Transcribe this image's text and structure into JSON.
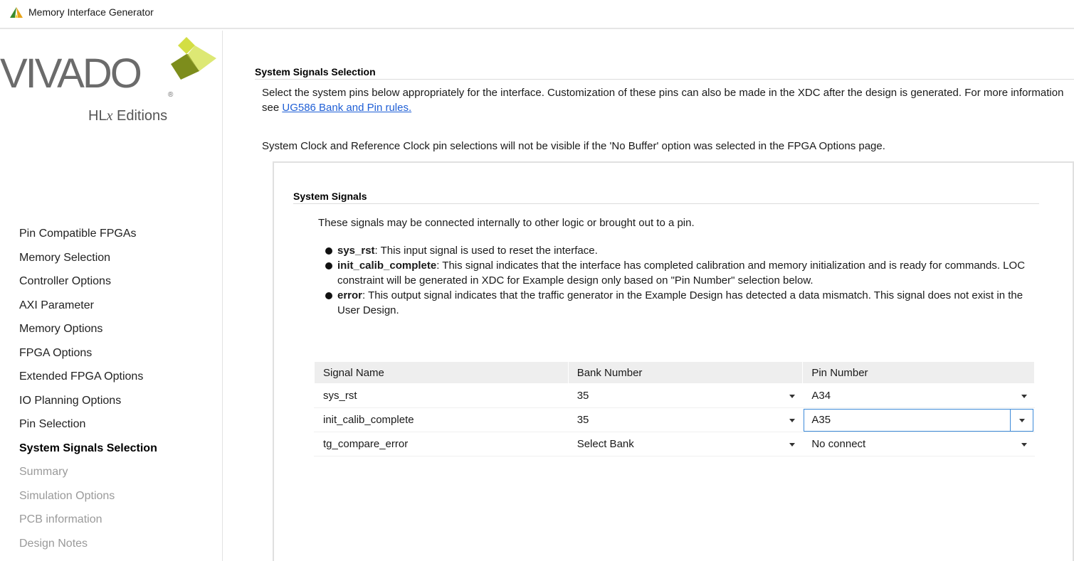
{
  "window": {
    "title": "Memory Interface Generator",
    "icon": "vivado-app-icon"
  },
  "logo": {
    "word": "VIVADO",
    "reg": "®",
    "sub_prefix": "HL",
    "sub_italic": "x",
    "sub_suffix": " Editions"
  },
  "sidebar": {
    "items": [
      {
        "label": "Pin Compatible FPGAs",
        "state": "normal"
      },
      {
        "label": "Memory Selection",
        "state": "normal"
      },
      {
        "label": "Controller Options",
        "state": "normal"
      },
      {
        "label": "AXI Parameter",
        "state": "normal"
      },
      {
        "label": "Memory Options",
        "state": "normal"
      },
      {
        "label": "FPGA Options",
        "state": "normal"
      },
      {
        "label": "Extended FPGA Options",
        "state": "normal"
      },
      {
        "label": "IO Planning Options",
        "state": "normal"
      },
      {
        "label": "Pin Selection",
        "state": "normal"
      },
      {
        "label": "System Signals Selection",
        "state": "active"
      },
      {
        "label": "Summary",
        "state": "disabled"
      },
      {
        "label": "Simulation Options",
        "state": "disabled"
      },
      {
        "label": "PCB information",
        "state": "disabled"
      },
      {
        "label": "Design Notes",
        "state": "disabled"
      }
    ]
  },
  "main": {
    "title": "System Signals Selection",
    "intro_text": "Select the system pins below appropriately for the interface. Customization of these pins can also be made in the XDC after the design is generated. For more information see ",
    "intro_link": "UG586 Bank and Pin rules.",
    "note": "System Clock and Reference Clock pin selections will not be visible if the 'No Buffer' option was selected in the FPGA Options page.",
    "panel": {
      "title": "System Signals",
      "description": "These signals may be connected internally to other logic or brought out to a pin.",
      "bullets": [
        {
          "name": "sys_rst",
          "text": ": This input signal is used to reset the interface."
        },
        {
          "name": "init_calib_complete",
          "text": ": This signal indicates that the interface has completed calibration and memory initialization and is ready for commands. LOC constraint will be generated in XDC for Example design only based on \"Pin Number\" selection below."
        },
        {
          "name": "error",
          "text": ": This output signal indicates that the traffic generator in the Example Design has detected a data mismatch. This signal does not exist in the User Design."
        }
      ],
      "table": {
        "headers": [
          "Signal Name",
          "Bank Number",
          "Pin Number"
        ],
        "rows": [
          {
            "signal": "sys_rst",
            "bank": "35",
            "pin": "A34"
          },
          {
            "signal": "init_calib_complete",
            "bank": "35",
            "pin": "A35"
          },
          {
            "signal": "tg_compare_error",
            "bank": "Select Bank",
            "pin": "No connect"
          }
        ]
      }
    }
  },
  "colors": {
    "link": "#1f5fd6",
    "focus": "#3d8ad9",
    "logo_green_light": "#d5e04a",
    "logo_green_dark": "#7a8a1a"
  }
}
